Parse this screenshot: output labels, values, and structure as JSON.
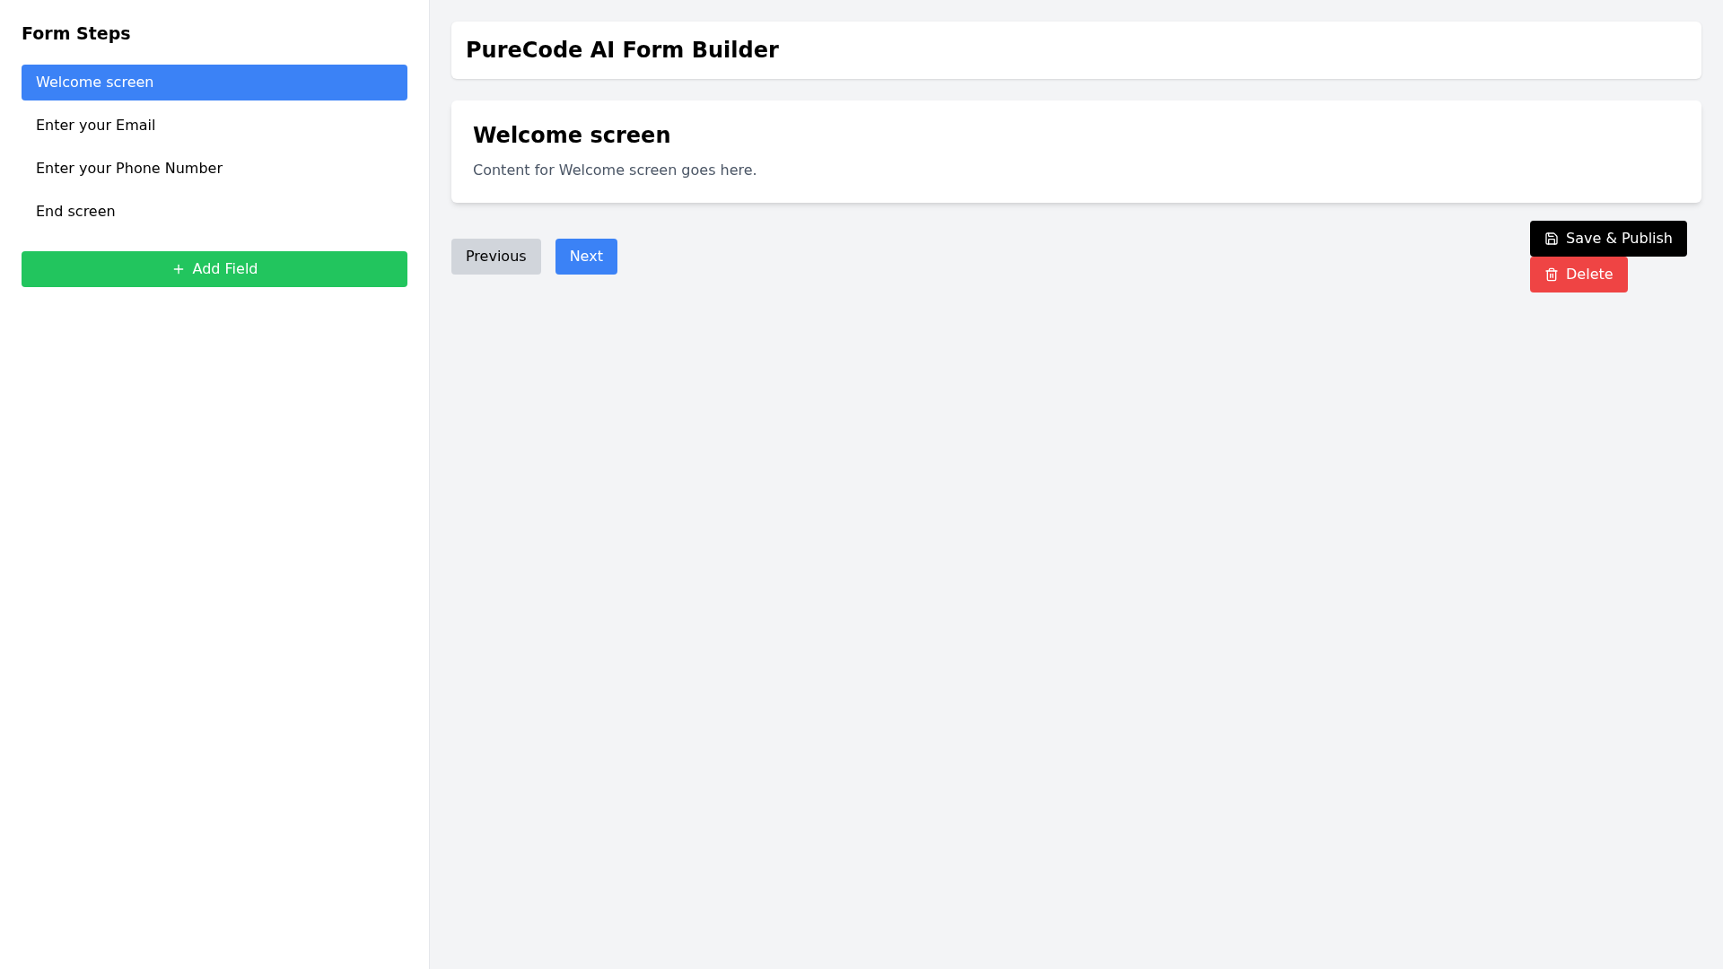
{
  "sidebar": {
    "title": "Form Steps",
    "items": [
      {
        "label": "Welcome screen",
        "selected": true
      },
      {
        "label": "Enter your Email",
        "selected": false
      },
      {
        "label": "Enter your Phone Number",
        "selected": false
      },
      {
        "label": "End screen",
        "selected": false
      }
    ],
    "add_button": "Add Field"
  },
  "header": {
    "title": "PureCode AI Form Builder"
  },
  "step_card": {
    "title": "Welcome screen",
    "content": "Content for Welcome screen goes here."
  },
  "navigation": {
    "previous": "Previous",
    "next": "Next"
  },
  "actions": {
    "save": "Save & Publish",
    "delete": "Delete"
  }
}
